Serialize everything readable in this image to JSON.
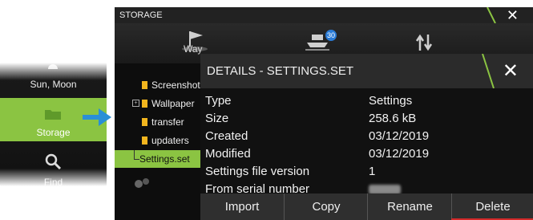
{
  "side_menu": {
    "items": [
      {
        "label": "Sun, Moon",
        "icon": "sun-icon"
      },
      {
        "label": "Storage",
        "icon": "folder-icon",
        "selected": true
      },
      {
        "label": "Find",
        "icon": "magnifier-icon"
      }
    ]
  },
  "storage_window": {
    "title": "STORAGE",
    "close": "✕",
    "toolbar_label": "Way",
    "badge": "30",
    "tree": [
      {
        "label": "Screenshots",
        "icon": "folder-icon"
      },
      {
        "label": "Wallpaper",
        "icon": "folder-icon",
        "expander": "+"
      },
      {
        "label": "transfer",
        "icon": "folder-icon"
      },
      {
        "label": "updaters",
        "icon": "folder-icon"
      },
      {
        "label": "Settings.set",
        "selected": true
      }
    ]
  },
  "details": {
    "title": "DETAILS - SETTINGS.SET",
    "close": "✕",
    "rows": [
      {
        "key": "Type",
        "value": "Settings"
      },
      {
        "key": "Size",
        "value": "258.6 kB"
      },
      {
        "key": "Created",
        "value": "03/12/2019"
      },
      {
        "key": "Modified",
        "value": "03/12/2019"
      },
      {
        "key": "Settings file version",
        "value": "1"
      },
      {
        "key": "From serial number",
        "value": ""
      }
    ],
    "buttons": [
      "Import",
      "Copy",
      "Rename",
      "Delete"
    ]
  },
  "colors": {
    "accent_green": "#8bc442",
    "delete_red": "#d42a2a",
    "arrow_blue": "#2a8fd6"
  }
}
